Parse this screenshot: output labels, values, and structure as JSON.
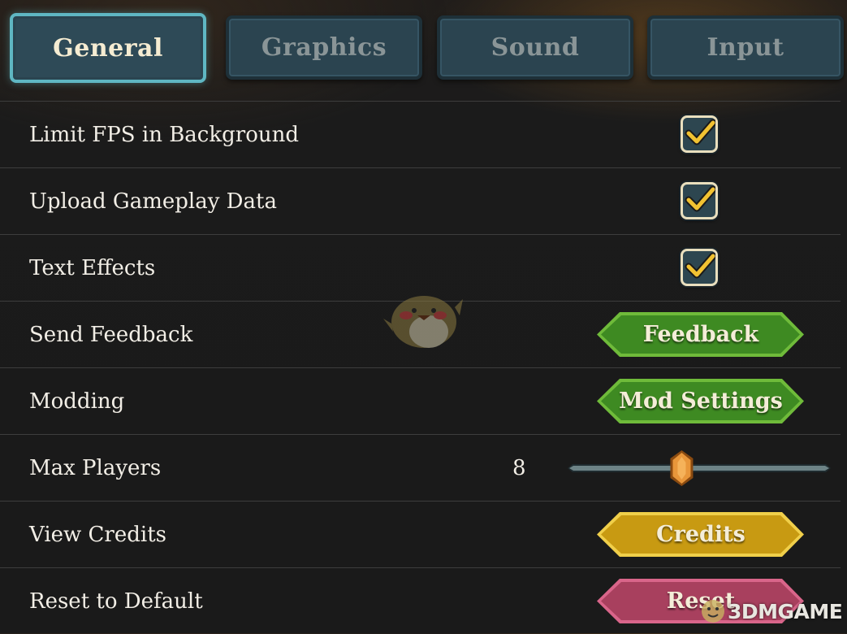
{
  "tabs": [
    {
      "label": "General",
      "active": true
    },
    {
      "label": "Graphics",
      "active": false
    },
    {
      "label": "Sound",
      "active": false
    },
    {
      "label": "Input",
      "active": false
    }
  ],
  "settings": {
    "limit_fps": {
      "label": "Limit FPS in Background",
      "checked": true
    },
    "upload_data": {
      "label": "Upload Gameplay Data",
      "checked": true
    },
    "text_effects": {
      "label": "Text Effects",
      "checked": true
    },
    "send_feedback": {
      "label": "Send Feedback",
      "button": "Feedback"
    },
    "modding": {
      "label": "Modding",
      "button": "Mod Settings"
    },
    "max_players": {
      "label": "Max Players",
      "value": "8",
      "slider_fraction": 0.43
    },
    "view_credits": {
      "label": "View Credits",
      "button": "Credits"
    },
    "reset": {
      "label": "Reset to Default",
      "button": "Reset"
    }
  },
  "colors": {
    "feedback_button": "#3e8a22",
    "mod_button": "#3e8a22",
    "credits_button": "#c89a12",
    "reset_button": "#a8405e",
    "checkbox_fill": "#2d4650",
    "check_mark": "#f1c232",
    "active_tab_border": "#5fb7c3"
  },
  "watermark": {
    "text": "3DMGAME"
  }
}
